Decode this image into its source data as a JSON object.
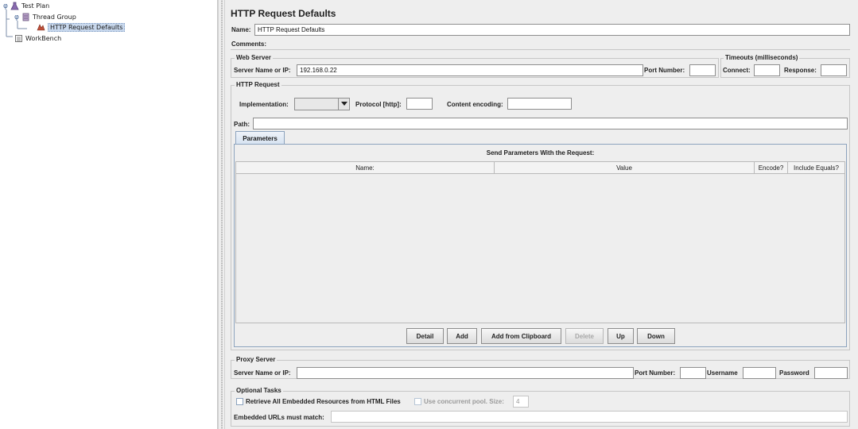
{
  "tree": {
    "items": [
      {
        "label": "Test Plan",
        "icon": "test-plan-icon"
      },
      {
        "label": "Thread Group",
        "icon": "thread-group-icon"
      },
      {
        "label": "HTTP Request Defaults",
        "icon": "config-element-icon"
      },
      {
        "label": "WorkBench",
        "icon": "workbench-icon"
      }
    ],
    "expander_glyph": "φ"
  },
  "panel": {
    "title": "HTTP Request Defaults",
    "name_label": "Name:",
    "name_value": "HTTP Request Defaults",
    "comments_label": "Comments:"
  },
  "web_server": {
    "title": "Web Server",
    "server_label": "Server Name or IP:",
    "server_value": "192.168.0.22",
    "port_label": "Port Number:",
    "port_value": ""
  },
  "timeouts": {
    "title": "Timeouts (milliseconds)",
    "connect_label": "Connect:",
    "response_label": "Response:"
  },
  "http_request": {
    "title": "HTTP Request",
    "implementation_label": "Implementation:",
    "implementation_value": "",
    "protocol_label": "Protocol [http]:",
    "encoding_label": "Content encoding:",
    "path_label": "Path:"
  },
  "parameters": {
    "tab_label": "Parameters",
    "table_title": "Send Parameters With the Request:",
    "columns": [
      "Name:",
      "Value",
      "Encode?",
      "Include Equals?"
    ],
    "buttons": [
      {
        "label": "Detail",
        "enabled": true
      },
      {
        "label": "Add",
        "enabled": true
      },
      {
        "label": "Add from Clipboard",
        "enabled": true
      },
      {
        "label": "Delete",
        "enabled": false
      },
      {
        "label": "Up",
        "enabled": true
      },
      {
        "label": "Down",
        "enabled": true
      }
    ]
  },
  "proxy": {
    "title": "Proxy Server",
    "server_label": "Server Name or IP:",
    "port_label": "Port Number:",
    "username_label": "Username",
    "password_label": "Password"
  },
  "optional": {
    "title": "Optional Tasks",
    "retrieve_label": "Retrieve All Embedded Resources from HTML Files",
    "retrieve_checked": false,
    "pool_label": "Use concurrent pool. Size:",
    "pool_checked": false,
    "pool_value": "4",
    "embedded_label": "Embedded URLs must match:"
  },
  "colors": {
    "panel_bg": "#eeeeee",
    "selection": "#c9d9ee",
    "tab_border": "#8ca3be"
  }
}
